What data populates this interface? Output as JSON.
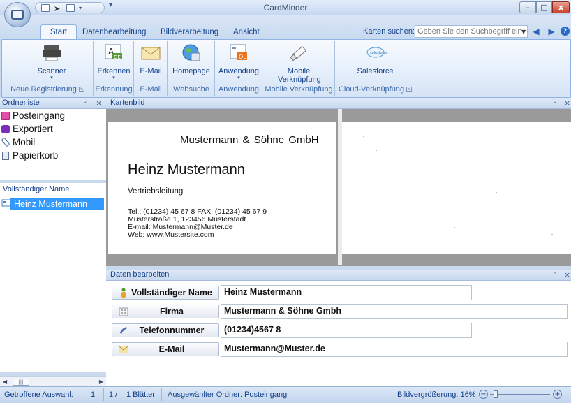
{
  "window": {
    "title": "CardMinder",
    "controls": {
      "minimize": "–",
      "maximize": "□",
      "close": "x"
    }
  },
  "qat": {
    "more": "▾"
  },
  "ribbon": {
    "tabs": [
      "Start",
      "Datenbearbeitung",
      "Bildverarbeitung",
      "Ansicht"
    ],
    "active_tab": "Start",
    "search": {
      "label": "Karten suchen:",
      "placeholder": "Geben Sie den Suchbegriff ein"
    },
    "groups": [
      {
        "label": "Neue Registrierung",
        "buttons": [
          {
            "label": "Scanner",
            "icon": "scanner-icon"
          }
        ]
      },
      {
        "label": "Erkennung",
        "buttons": [
          {
            "label": "Erkennen",
            "icon": "recognize-icon"
          }
        ]
      },
      {
        "label": "E-Mail",
        "buttons": [
          {
            "label": "E-Mail",
            "icon": "envelope-icon"
          }
        ]
      },
      {
        "label": "Websuche",
        "buttons": [
          {
            "label": "Homepage",
            "icon": "globe-icon"
          }
        ]
      },
      {
        "label": "Anwendung",
        "buttons": [
          {
            "label": "Anwendung",
            "icon": "application-icon"
          }
        ]
      },
      {
        "label": "Mobile Verknüpfung",
        "buttons": [
          {
            "label": "Mobile Verknüpfung",
            "icon": "usb-stick-icon"
          }
        ]
      },
      {
        "label": "Cloud-Verknüpfung",
        "buttons": [
          {
            "label": "Salesforce",
            "icon": "salesforce-icon"
          }
        ]
      }
    ]
  },
  "folders": {
    "header": "Ordnerliste",
    "items": [
      {
        "label": "Posteingang",
        "icon": "inbox-folder-icon",
        "color": "#e34fa8"
      },
      {
        "label": "Exportiert",
        "icon": "export-icon",
        "color": "#7a2fb8"
      },
      {
        "label": "Mobil",
        "icon": "mobile-icon",
        "color": "#4a6fa5"
      },
      {
        "label": "Papierkorb",
        "icon": "trash-icon",
        "color": "#5b6f8f"
      }
    ]
  },
  "names": {
    "header": "Vollständiger Name",
    "items": [
      "Heinz Mustermann"
    ],
    "selected": "Heinz Mustermann"
  },
  "card": {
    "header": "Kartenbild",
    "company": "Mustermann & Söhne GmbH",
    "name": "Heinz Mustermann",
    "position": "Vertriebsleitung",
    "lines": [
      "Tel.: (01234) 45 67 8 FAX: (01234) 45 67 9",
      "Musterstraße 1, 123456 Musterstadt"
    ],
    "email_prefix": "E-mail: ",
    "email": "Mustermann@Muster.de",
    "web": "Web: www.Mustersite.com"
  },
  "edit": {
    "header": "Daten bearbeiten",
    "fields": [
      {
        "label": "Vollständiger Name",
        "value": "Heinz Mustermann",
        "icon": "person-icon"
      },
      {
        "label": "Firma",
        "value": "Mustermann & Söhne Gmbh",
        "icon": "building-icon"
      },
      {
        "label": "Telefonnummer",
        "value": "(01234)4567 8",
        "icon": "phone-icon"
      },
      {
        "label": "E-Mail",
        "value": "Mustermann@Muster.de",
        "icon": "envelope-icon"
      }
    ]
  },
  "status": {
    "selection_label": "Getroffene Auswahl:",
    "selection_count": "1",
    "page": "1 /",
    "sheets": "1 Blätter",
    "folder": "Ausgewählter Ordner: Posteingang",
    "zoom_label": "Bildvergrößerung: 16%",
    "zoom_percent": 16
  },
  "pane_controls": {
    "pin": "ᵖ",
    "close": "×"
  },
  "colors": {
    "accent": "#15428b",
    "selection": "#3399ff",
    "ribbon": "#dbe7f6"
  }
}
